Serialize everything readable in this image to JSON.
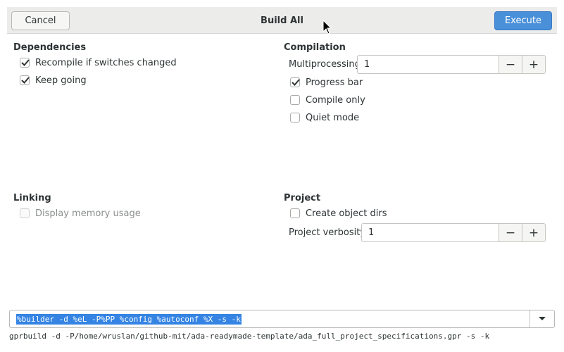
{
  "header": {
    "cancel_label": "Cancel",
    "title": "Build All",
    "execute_label": "Execute"
  },
  "dependencies": {
    "title": "Dependencies",
    "recompile": {
      "label": "Recompile if switches changed",
      "checked": true
    },
    "keep_going": {
      "label": "Keep going",
      "checked": true
    }
  },
  "compilation": {
    "title": "Compilation",
    "multiprocessing_label": "Multiprocessing",
    "multiprocessing_value": "1",
    "progress_bar": {
      "label": "Progress bar",
      "checked": true
    },
    "compile_only": {
      "label": "Compile only",
      "checked": false
    },
    "quiet_mode": {
      "label": "Quiet mode",
      "checked": false
    }
  },
  "linking": {
    "title": "Linking",
    "display_memory": {
      "label": "Display memory usage",
      "checked": false,
      "disabled": true
    }
  },
  "project": {
    "title": "Project",
    "create_object_dirs": {
      "label": "Create object dirs",
      "checked": false
    },
    "verbosity_label": "Project verbosity",
    "verbosity_value": "1"
  },
  "spin_symbols": {
    "minus": "−",
    "plus": "+"
  },
  "command": {
    "template": "%builder -d %eL -P%PP %config %autoconf %X -s -k",
    "resolved": "gprbuild -d -P/home/wruslan/github-mit/ada-readymade-template/ada_full_project_specifications.gpr -s -k"
  },
  "colors": {
    "accent": "#4a90d9",
    "selection": "#3584e4"
  }
}
